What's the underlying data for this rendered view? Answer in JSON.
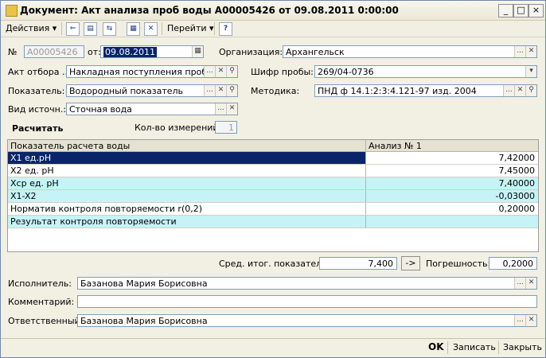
{
  "window": {
    "title": "Документ: Акт анализа проб воды А00005426 от 09.08.2011 0:00:00"
  },
  "toolbar": {
    "actions_label": "Действия",
    "goto_label": "Перейти",
    "help_label": "?"
  },
  "form": {
    "number_label": "№",
    "number_value": "А00005426",
    "from_label": "от:",
    "date_value": "09.08.2011",
    "org_label": "Организация:",
    "org_value": "Архангельск",
    "act_label": "Акт отбора ...",
    "act_value": "Накладная поступления проб вод...",
    "cipher_label": "Шифр пробы:",
    "cipher_value": "269/04-0736",
    "indicator_label": "Показатель:",
    "indicator_value": "Водородный показатель",
    "method_label": "Методика:",
    "method_value": "ПНД ф 14.1:2:3:4.121-97 изд. 2004",
    "source_label": "Вид источн.:",
    "source_value": "Сточная вода",
    "calculate_label": "Расчитать",
    "measure_count_label": "Кол-во измерений:",
    "measure_count_value": "1"
  },
  "grid": {
    "headers": [
      "Показатель расчета воды",
      "Анализ № 1"
    ],
    "rows": [
      {
        "name": "X1 ед.pH",
        "value": "7,42000"
      },
      {
        "name": "X2 ед. pH",
        "value": "7,45000"
      },
      {
        "name": "Xср ед. pH",
        "value": "7,40000"
      },
      {
        "name": "X1-X2",
        "value": "-0,03000"
      },
      {
        "name": "Норматив контроля повторяемости r(0,2)",
        "value": "0,20000"
      },
      {
        "name": "Результат контроля повторяемости",
        "value": ""
      }
    ]
  },
  "summary": {
    "avg_label": "Сред. итог. показателя:",
    "avg_value": "7,400",
    "arrow_label": "->",
    "error_label": "Погрешность:",
    "error_value": "0,2000"
  },
  "people": {
    "executor_label": "Исполнитель:",
    "executor_value": "Базанова Мария Борисовна",
    "comment_label": "Комментарий:",
    "comment_value": "",
    "responsible_label": "Ответственный:",
    "responsible_value": "Базанова Мария Борисовна"
  },
  "footer": {
    "ok_label": "OK",
    "save_label": "Записать",
    "close_label": "Закрыть"
  },
  "colors": {
    "selected_row": "#0a246a",
    "highlight_row": "#c5f3f6",
    "accent": "#0a246a"
  }
}
